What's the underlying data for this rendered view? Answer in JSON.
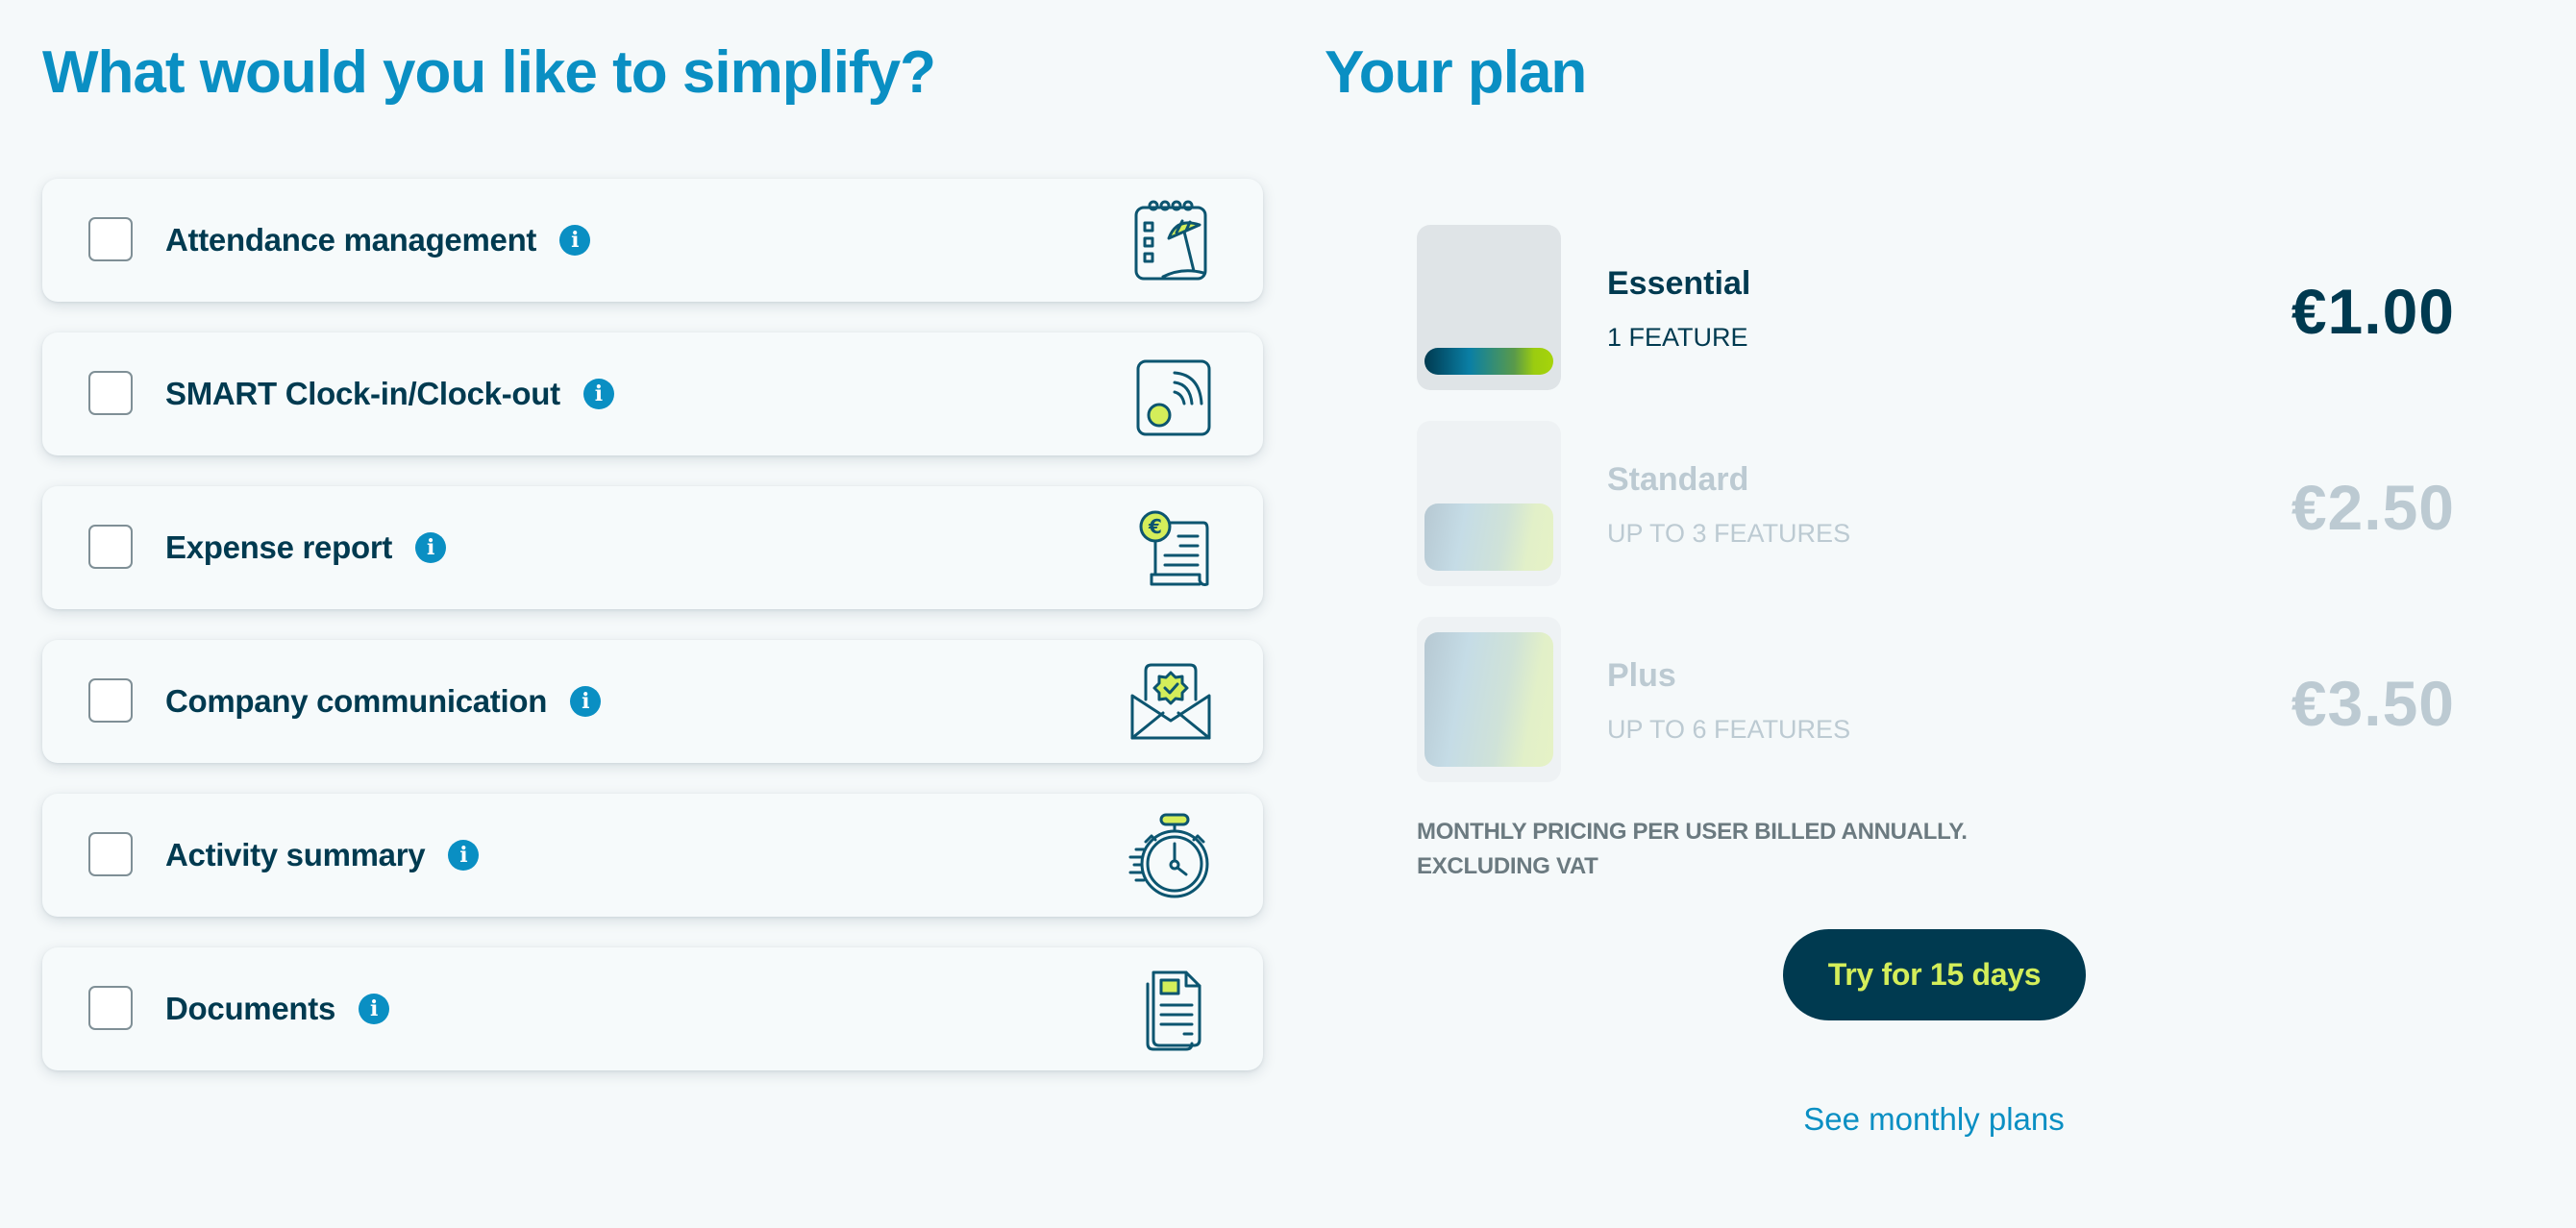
{
  "left": {
    "heading": "What would you like to simplify?",
    "features": [
      {
        "label": "Attendance management",
        "icon": "calendar-umbrella-icon",
        "checked": false
      },
      {
        "label": "SMART Clock-in/Clock-out",
        "icon": "smart-clock-signal-icon",
        "checked": false
      },
      {
        "label": "Expense report",
        "icon": "euro-receipt-icon",
        "checked": false
      },
      {
        "label": "Company communication",
        "icon": "envelope-badge-icon",
        "checked": false
      },
      {
        "label": "Activity summary",
        "icon": "stopwatch-icon",
        "checked": false
      },
      {
        "label": "Documents",
        "icon": "documents-icon",
        "checked": false
      }
    ],
    "info_icon_glyph": "i"
  },
  "right": {
    "heading": "Your plan",
    "plans": [
      {
        "name": "Essential",
        "features": "1 FEATURE",
        "price": "€1.00",
        "selected": true,
        "fill_level": 0.17
      },
      {
        "name": "Standard",
        "features": "UP TO 3 FEATURES",
        "price": "€2.50",
        "selected": false,
        "fill_level": 0.5
      },
      {
        "name": "Plus",
        "features": "UP TO 6 FEATURES",
        "price": "€3.50",
        "selected": false,
        "fill_level": 1.0
      }
    ],
    "note_line1": "MONTHLY PRICING PER USER BILLED ANNUALLY.",
    "note_line2": "EXCLUDING VAT",
    "cta_label": "Try for 15 days",
    "link_label": "See monthly plans"
  },
  "colors": {
    "accent": "#0a8fc3",
    "dark": "#003a50",
    "lime": "#d4ee5a",
    "muted": "#bccad2",
    "background": "#f5f9fa"
  }
}
